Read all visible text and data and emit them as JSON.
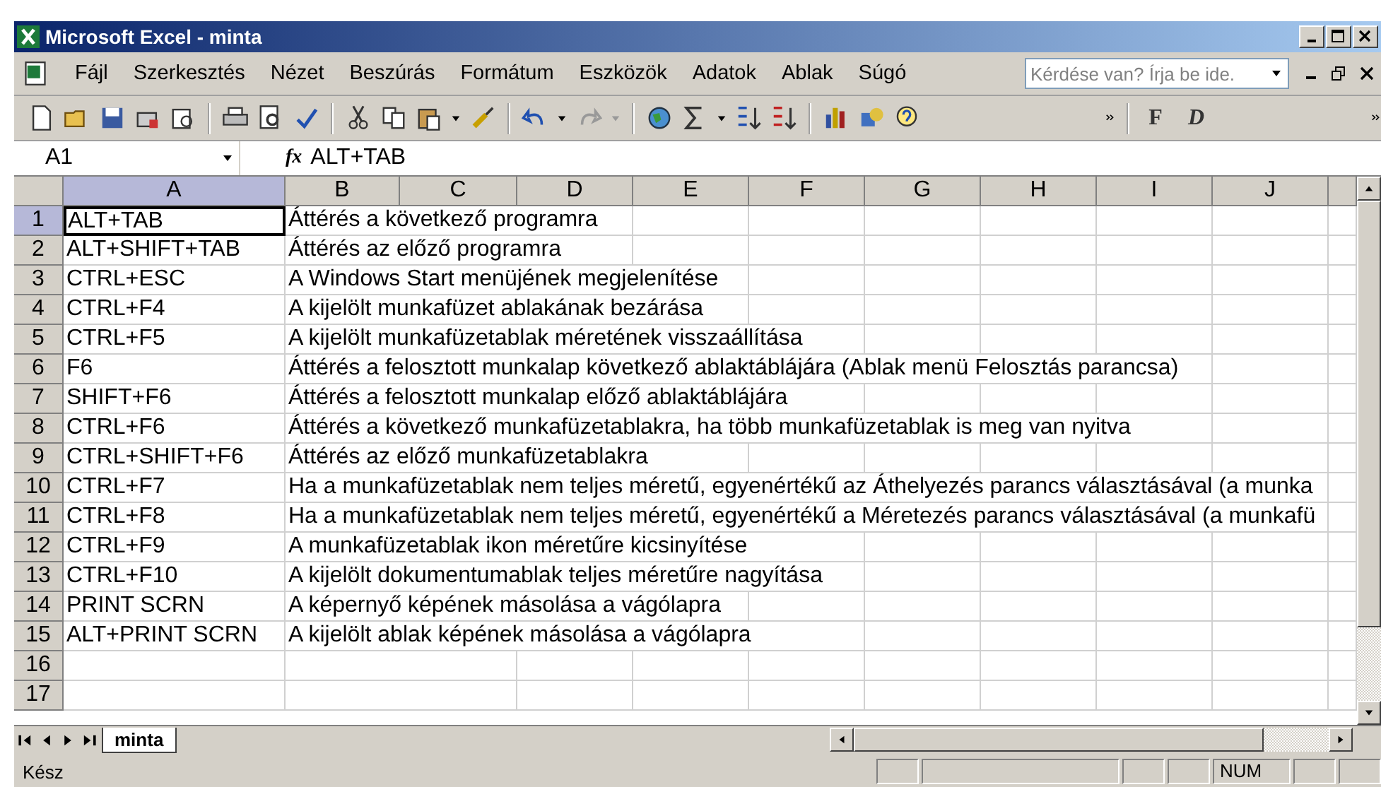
{
  "window": {
    "title": "Microsoft Excel - minta"
  },
  "menu": [
    {
      "label": "Fájl"
    },
    {
      "label": "Szerkesztés"
    },
    {
      "label": "Nézet"
    },
    {
      "label": "Beszúrás"
    },
    {
      "label": "Formátum"
    },
    {
      "label": "Eszközök"
    },
    {
      "label": "Adatok"
    },
    {
      "label": "Ablak"
    },
    {
      "label": "Súgó"
    }
  ],
  "help_box": {
    "placeholder": "Kérdése van? Írja be ide."
  },
  "toolbar_font_buttons": [
    "F",
    "D"
  ],
  "formula_bar": {
    "name_box": "A1",
    "fx": "fx",
    "value": "ALT+TAB"
  },
  "grid": {
    "columns": [
      {
        "label": "A",
        "selected": true
      },
      {
        "label": "B",
        "selected": false
      },
      {
        "label": "C",
        "selected": false
      },
      {
        "label": "D",
        "selected": false
      },
      {
        "label": "E",
        "selected": false
      },
      {
        "label": "F",
        "selected": false
      },
      {
        "label": "G",
        "selected": false
      },
      {
        "label": "H",
        "selected": false
      },
      {
        "label": "I",
        "selected": false
      },
      {
        "label": "J",
        "selected": false
      }
    ],
    "rows": [
      {
        "number": "1",
        "selected": true,
        "key": "ALT+TAB",
        "description": "Áttérés a következő programra"
      },
      {
        "number": "2",
        "selected": false,
        "key": "ALT+SHIFT+TAB",
        "description": "Áttérés az előző programra"
      },
      {
        "number": "3",
        "selected": false,
        "key": "CTRL+ESC",
        "description": "A Windows Start menüjének megjelenítése"
      },
      {
        "number": "4",
        "selected": false,
        "key": "CTRL+F4",
        "description": "A kijelölt munkafüzet ablakának bezárása"
      },
      {
        "number": "5",
        "selected": false,
        "key": "CTRL+F5",
        "description": "A kijelölt munkafüzetablak méretének visszaállítása"
      },
      {
        "number": "6",
        "selected": false,
        "key": "F6",
        "description": "Áttérés a felosztott munkalap következő ablaktáblájára (Ablak menü Felosztás parancsa)"
      },
      {
        "number": "7",
        "selected": false,
        "key": "SHIFT+F6",
        "description": "Áttérés a felosztott munkalap előző ablaktáblájára"
      },
      {
        "number": "8",
        "selected": false,
        "key": "CTRL+F6",
        "description": "Áttérés a következő munkafüzetablakra, ha több munkafüzetablak is meg van nyitva"
      },
      {
        "number": "9",
        "selected": false,
        "key": "CTRL+SHIFT+F6",
        "description": "Áttérés az előző munkafüzetablakra"
      },
      {
        "number": "10",
        "selected": false,
        "key": "CTRL+F7",
        "description": "Ha a munkafüzetablak nem teljes méretű, egyenértékű az Áthelyezés parancs választásával (a munka"
      },
      {
        "number": "11",
        "selected": false,
        "key": "CTRL+F8",
        "description": "Ha a munkafüzetablak nem teljes méretű, egyenértékű a Méretezés parancs választásával (a munkafü"
      },
      {
        "number": "12",
        "selected": false,
        "key": "CTRL+F9",
        "description": "A munkafüzetablak ikon méretűre kicsinyítése"
      },
      {
        "number": "13",
        "selected": false,
        "key": "CTRL+F10",
        "description": "A kijelölt dokumentumablak teljes méretűre nagyítása"
      },
      {
        "number": "14",
        "selected": false,
        "key": "PRINT SCRN",
        "description": "A képernyő képének másolása a vágólapra"
      },
      {
        "number": "15",
        "selected": false,
        "key": "ALT+PRINT SCRN",
        "description": "A kijelölt ablak képének másolása a vágólapra"
      },
      {
        "number": "16",
        "selected": false,
        "key": "",
        "description": ""
      },
      {
        "number": "17",
        "selected": false,
        "key": "",
        "description": ""
      }
    ]
  },
  "sheet_tabs": [
    {
      "label": "minta",
      "selected": true
    }
  ],
  "status_bar": {
    "text": "Kész",
    "indicator": "NUM"
  }
}
